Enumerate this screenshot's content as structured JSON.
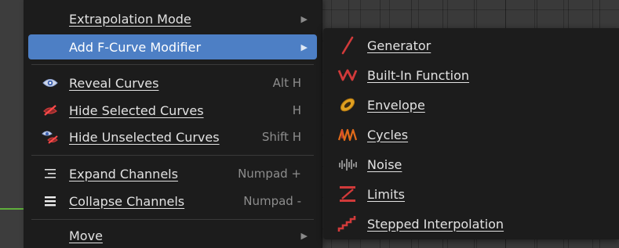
{
  "menu": {
    "items": [
      {
        "label": "Extrapolation Mode",
        "shortcut": "",
        "icon": "none",
        "submenu": true,
        "active": false
      },
      {
        "label": "Add F-Curve Modifier",
        "shortcut": "",
        "icon": "none",
        "submenu": true,
        "active": true
      },
      {
        "label": "Reveal Curves",
        "shortcut": "Alt H",
        "icon": "eye-icon",
        "submenu": false,
        "active": false
      },
      {
        "label": "Hide Selected Curves",
        "shortcut": "H",
        "icon": "eye-hidden-icon",
        "submenu": false,
        "active": false
      },
      {
        "label": "Hide Unselected Curves",
        "shortcut": "Shift H",
        "icon": "eye-hidden-unselected-icon",
        "submenu": false,
        "active": false
      },
      {
        "label": "Expand Channels",
        "shortcut": "Numpad +",
        "icon": "expand-lines-icon",
        "submenu": false,
        "active": false
      },
      {
        "label": "Collapse Channels",
        "shortcut": "Numpad -",
        "icon": "collapse-lines-icon",
        "submenu": false,
        "active": false
      },
      {
        "label": "Move",
        "shortcut": "",
        "icon": "none",
        "submenu": true,
        "active": false
      }
    ],
    "arrow_glyph": "▶"
  },
  "submenu": {
    "items": [
      {
        "label": "Generator",
        "icon": "generator-icon"
      },
      {
        "label": "Built-In Function",
        "icon": "builtin-function-icon"
      },
      {
        "label": "Envelope",
        "icon": "envelope-icon"
      },
      {
        "label": "Cycles",
        "icon": "cycles-icon"
      },
      {
        "label": "Noise",
        "icon": "noise-icon"
      },
      {
        "label": "Limits",
        "icon": "limits-icon"
      },
      {
        "label": "Stepped Interpolation",
        "icon": "stepped-interpolation-icon"
      }
    ]
  },
  "colors": {
    "menu_bg": "#1c1c1c",
    "highlight": "#4d7fc5",
    "text": "#e2e2e2",
    "shortcut": "#8d8d8d",
    "icon_red": "#d13a3a",
    "icon_orange": "#e0a020",
    "channel_green": "#5fae3c"
  }
}
